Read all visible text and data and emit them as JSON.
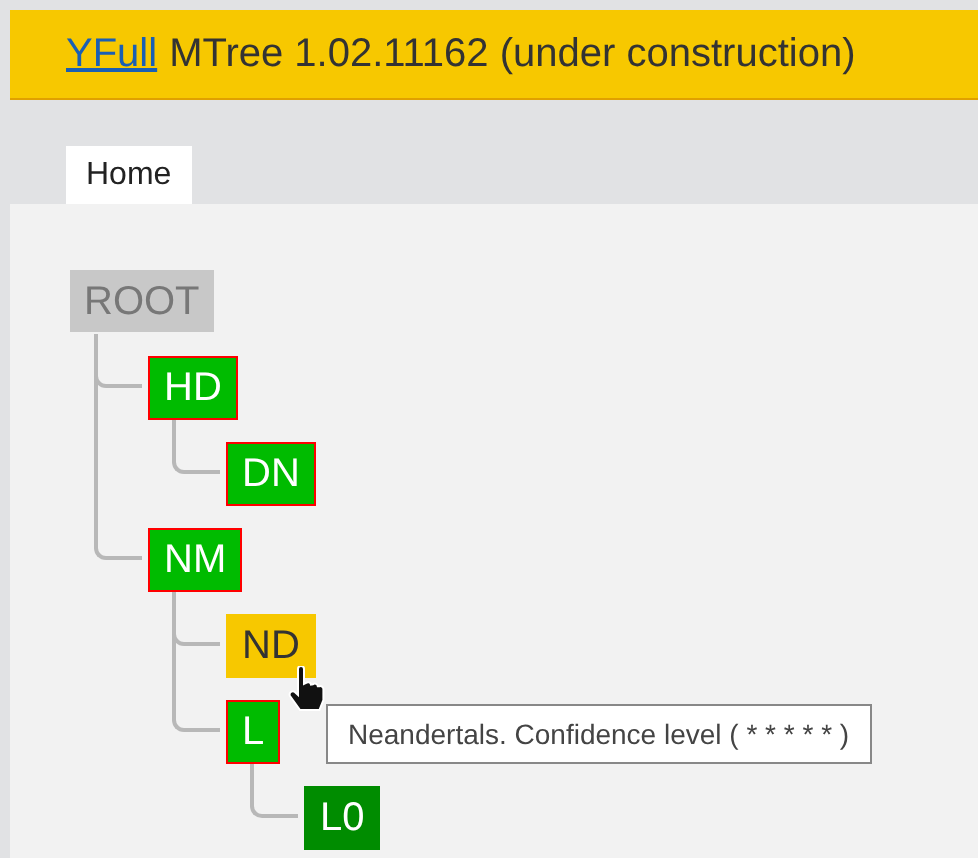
{
  "header": {
    "link": "YFull",
    "title": "MTree 1.02.11162 (under construction)"
  },
  "tabs": [
    {
      "label": "Home",
      "selected": true
    }
  ],
  "tree": {
    "label": "ROOT",
    "kind": "root",
    "children": [
      {
        "label": "HD",
        "kind": "node",
        "color": "#00bb00",
        "outlined": true,
        "children": [
          {
            "label": "DN",
            "kind": "node",
            "color": "#00bb00",
            "outlined": true
          }
        ]
      },
      {
        "label": "NM",
        "kind": "node",
        "color": "#00bb00",
        "outlined": true,
        "children": [
          {
            "label": "ND",
            "kind": "node",
            "color": "#f7c800",
            "outlined": false
          },
          {
            "label": "L",
            "kind": "node",
            "color": "#00bb00",
            "outlined": true,
            "children": [
              {
                "label": "L0",
                "kind": "node",
                "color": "#008c00",
                "outlined": false
              }
            ]
          }
        ]
      }
    ]
  },
  "tooltip": {
    "text": "Neandertals. Confidence level ( * * * * * )"
  }
}
